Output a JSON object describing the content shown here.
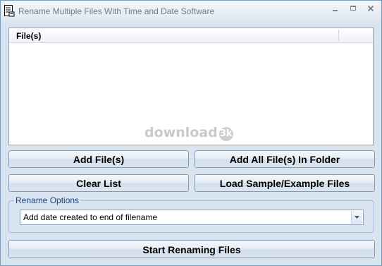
{
  "window": {
    "title": "Rename Multiple Files With Time and Date Software",
    "icons": [
      "app-icon",
      "minimize-icon",
      "maximize-icon",
      "close-icon"
    ]
  },
  "file_list": {
    "columns": [
      "File(s)"
    ],
    "rows": [],
    "watermark": "download",
    "watermark_badge": "3k"
  },
  "buttons": {
    "add_files": "Add File(s)",
    "add_all": "Add All File(s) In Folder",
    "clear_list": "Clear List",
    "load_sample": "Load Sample/Example Files",
    "start": "Start Renaming Files"
  },
  "rename_options": {
    "label": "Rename Options",
    "selected": "Add date created to end of filename"
  },
  "colors": {
    "window_bg": "#d9e4f1",
    "group_label": "#1f3f7a"
  }
}
